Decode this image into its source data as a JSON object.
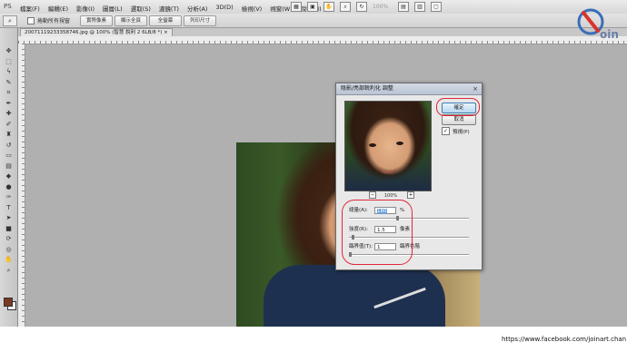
{
  "app": {
    "logo": "PS",
    "menus": [
      "檔案(F)",
      "編輯(E)",
      "影像(I)",
      "圖層(L)",
      "選取(S)",
      "濾鏡(T)",
      "分析(A)",
      "3D(D)",
      "檢視(V)",
      "視窗(W)",
      "說明(H)"
    ],
    "zoom_level": "100%"
  },
  "options_bar": {
    "checkbox_label": "捲動所有視窗",
    "buttons": [
      "實際像素",
      "顯示全頁",
      "全螢幕",
      "列印尺寸"
    ]
  },
  "document": {
    "tab_label": "20071119233358746.jpg @ 100% (智慧 銳利 2 6LB/8 *) ×"
  },
  "dialog": {
    "title": "陰影/亮部銳利化 調整",
    "ok_label": "確定",
    "cancel_label": "取消",
    "preview_label": "預視(P)",
    "preview_checked": true,
    "zoom_percent": "100%",
    "amount_label": "總量(A):",
    "amount_value": "180",
    "amount_unit": "%",
    "radius_label": "強度(R):",
    "radius_value": "1.5",
    "radius_unit": "像素",
    "threshold_label": "臨界值(T):",
    "threshold_value": "1",
    "threshold_unit": "臨界色階",
    "slider_levels": {
      "amount": 0.4,
      "radius": 0.02,
      "threshold": 0.0
    }
  },
  "watermark": {
    "text": "oin"
  },
  "footer": {
    "url": "https://www.facebook.com/joinart.chan"
  },
  "colors": {
    "annotation_red": "#e0253a",
    "foreground_swatch": "#7a3a22",
    "ok_button_blue": "#3c7fb1"
  }
}
